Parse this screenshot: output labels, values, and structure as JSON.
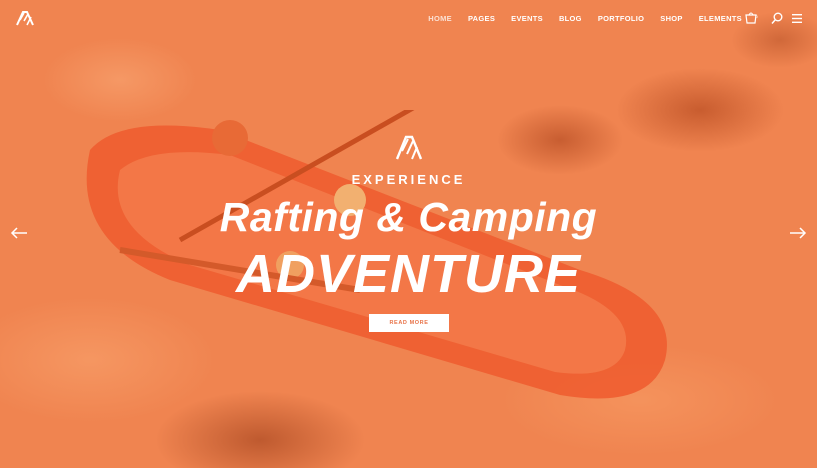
{
  "nav": {
    "items": [
      {
        "label": "HOME",
        "active": true
      },
      {
        "label": "PAGES",
        "active": false
      },
      {
        "label": "EVENTS",
        "active": false
      },
      {
        "label": "BLOG",
        "active": false
      },
      {
        "label": "PORTFOLIO",
        "active": false
      },
      {
        "label": "SHOP",
        "active": false
      },
      {
        "label": "ELEMENTS",
        "active": false
      }
    ],
    "cart_count": "0"
  },
  "icons": {
    "logo": "brand-logo-icon",
    "cart": "shopping-cart-icon",
    "search": "search-icon",
    "menu": "hamburger-menu-icon",
    "prev": "arrow-left-icon",
    "next": "arrow-right-icon"
  },
  "hero": {
    "eyebrow": "EXPERIENCE",
    "title_line1": "Rafting & Camping",
    "title_line2": "ADVENTURE",
    "cta_label": "READ MORE"
  },
  "colors": {
    "overlay": "#f08450",
    "text": "#ffffff",
    "cta_text": "#e8744a"
  }
}
